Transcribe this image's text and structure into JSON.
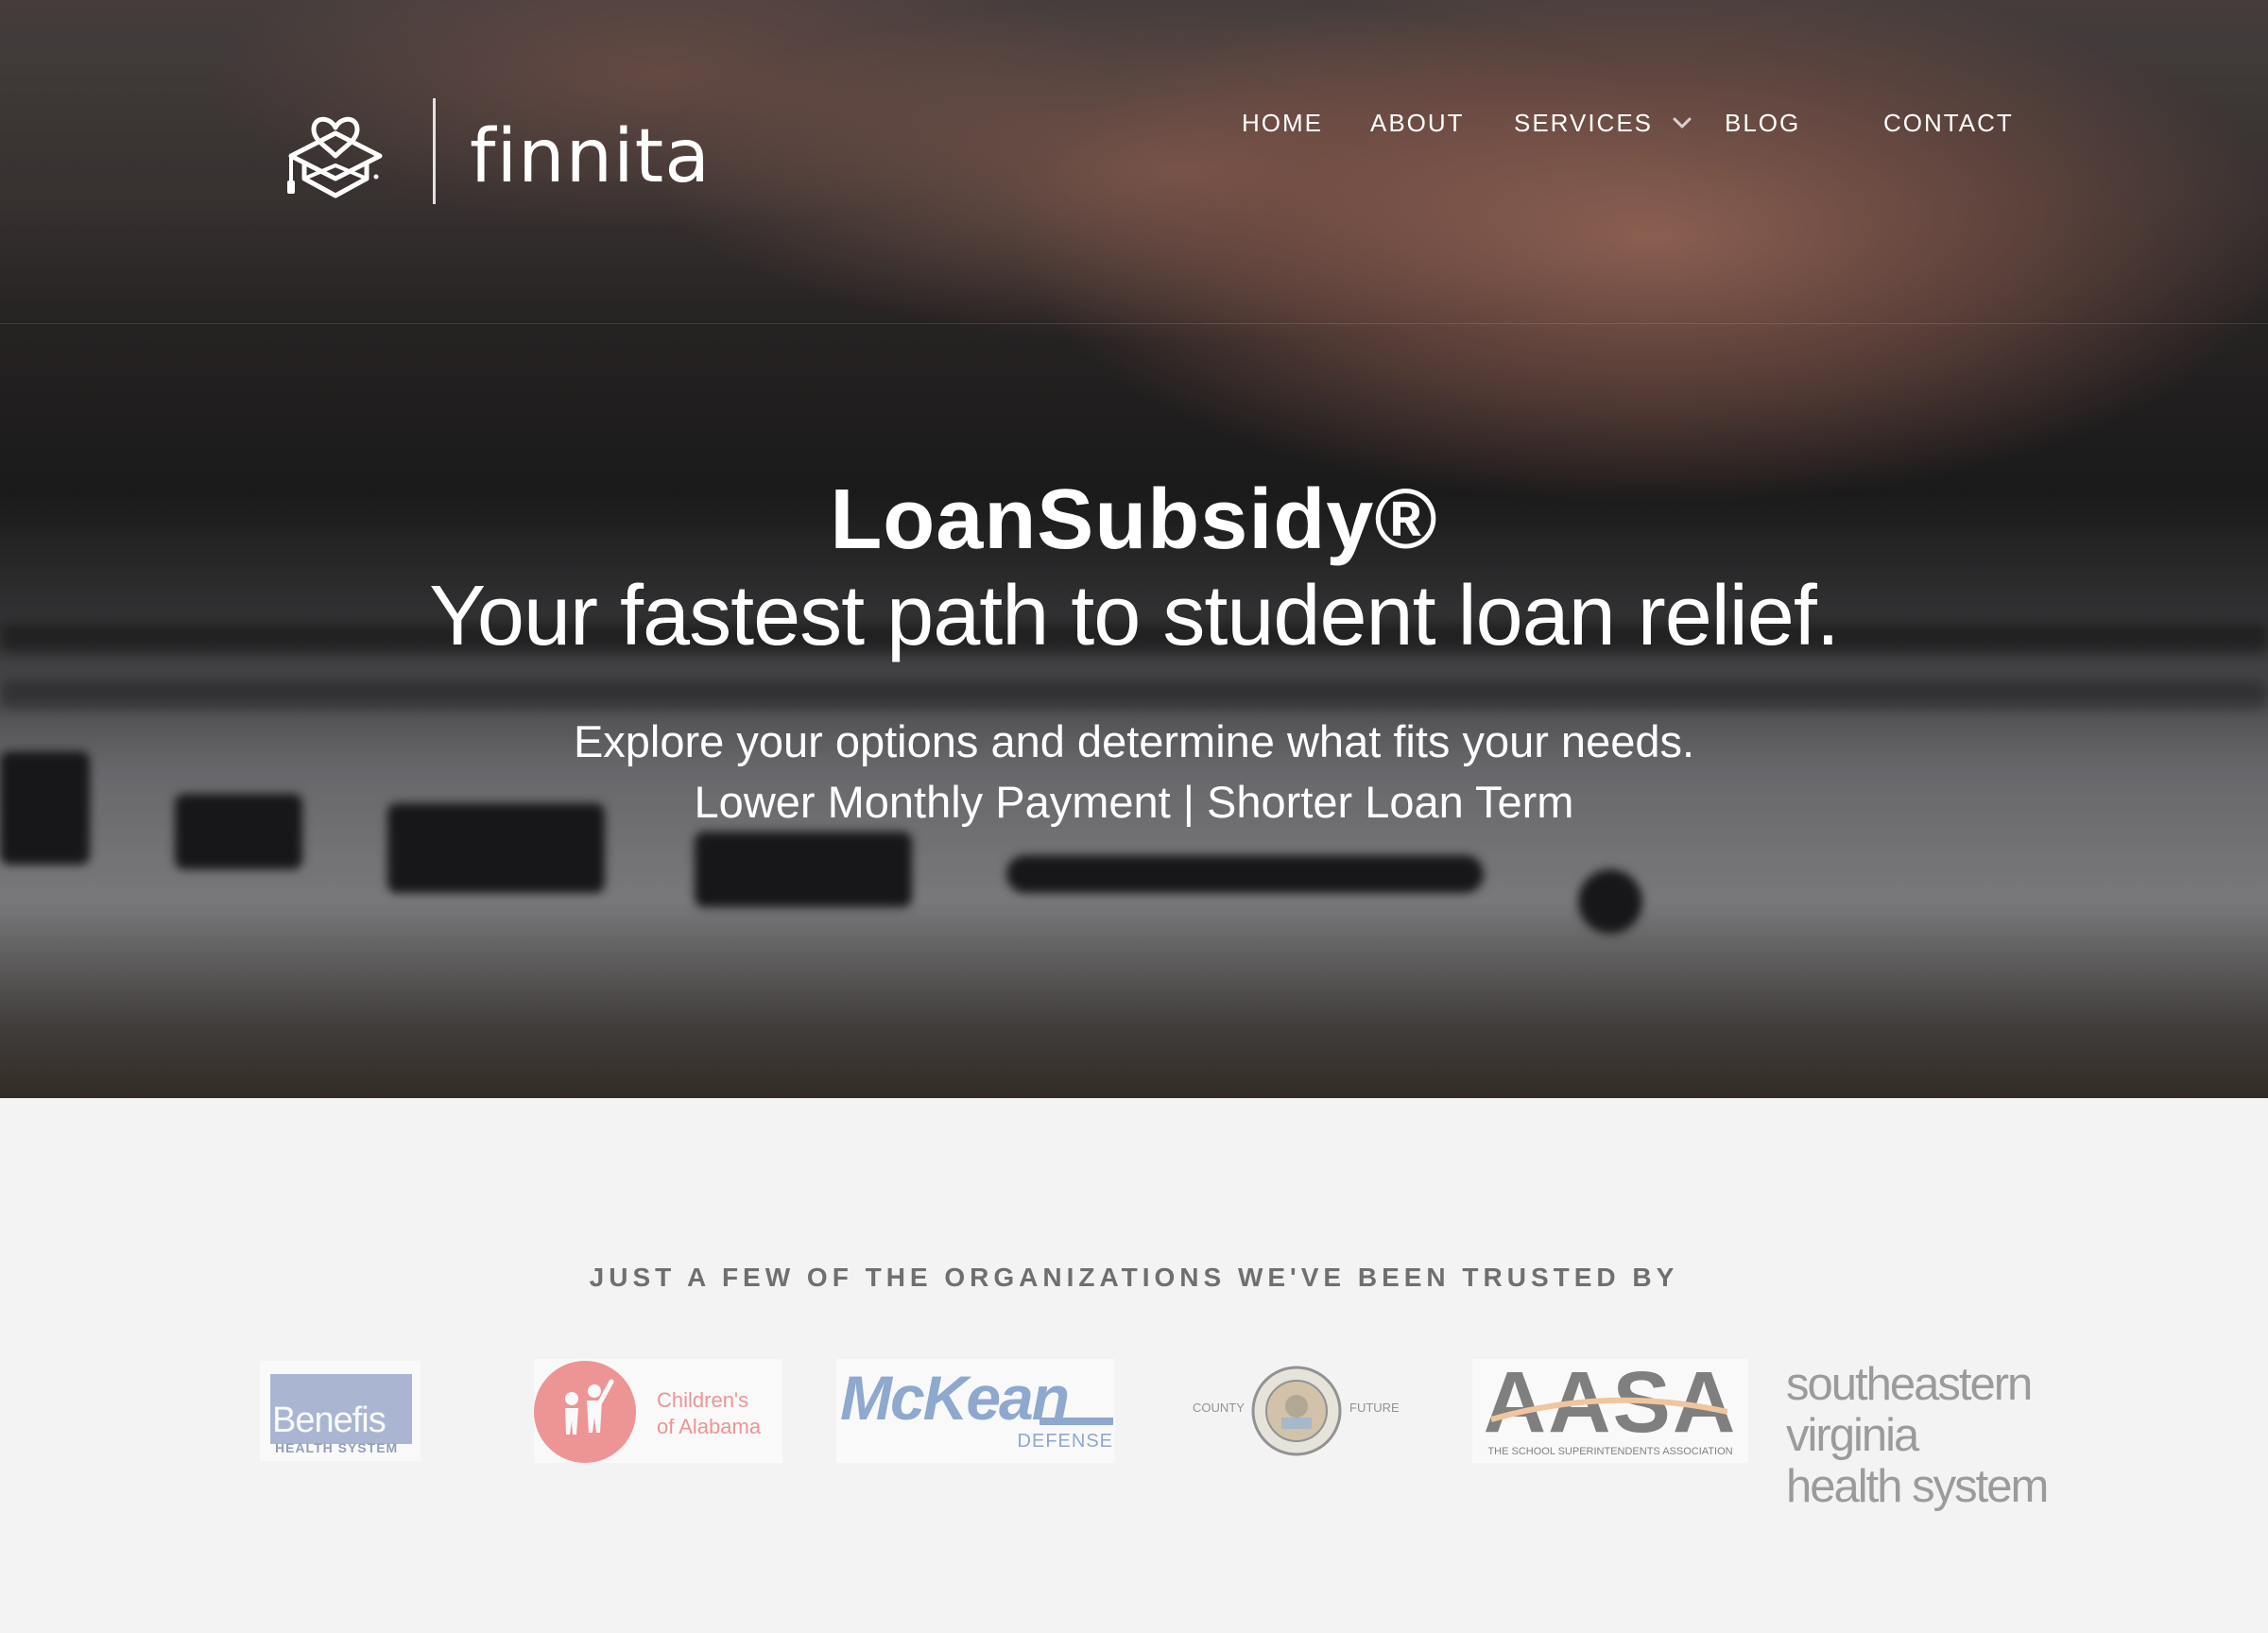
{
  "brand": {
    "name": "finnita",
    "icon": "graduation-heart-book-icon"
  },
  "nav": {
    "items": [
      {
        "label": "HOME"
      },
      {
        "label": "ABOUT"
      },
      {
        "label": "SERVICES",
        "icon": "chevron-down-icon"
      },
      {
        "label": "BLOG"
      },
      {
        "label": "CONTACT"
      }
    ]
  },
  "hero": {
    "product": "LoanSubsidy®",
    "tagline": "Your fastest path to student loan relief.",
    "subtitle": "Explore your options and determine what fits your needs.",
    "benefits": "Lower Monthly Payment | Shorter Loan Term"
  },
  "trusted": {
    "title": "JUST A FEW OF THE ORGANIZATIONS WE'VE BEEN TRUSTED BY",
    "orgs": {
      "benefis": {
        "name": "Benefis",
        "sub": "HEALTH SYSTEM"
      },
      "childrens": {
        "line1": "Children's",
        "line2": "of Alabama"
      },
      "mckean": {
        "name": "McKean",
        "sub": "DEFENSE"
      },
      "county": {
        "left": "COUNTY",
        "right": "FUTURE"
      },
      "aasa": {
        "name": "AASA",
        "sub": "THE SCHOOL SUPERINTENDENTS ASSOCIATION"
      },
      "svhs": {
        "line1": "southeastern virginia",
        "line2": "health system"
      }
    }
  },
  "colors": {
    "hero_text": "#ffffff",
    "section_bg": "#f3f3f3",
    "heading_gray": "#6f6f6f",
    "childrens_red": "#e9474a",
    "mckean_blue": "#3d6cb0",
    "benefis_blue": "#6f86b6",
    "aasa_orange": "#f0a05a"
  }
}
